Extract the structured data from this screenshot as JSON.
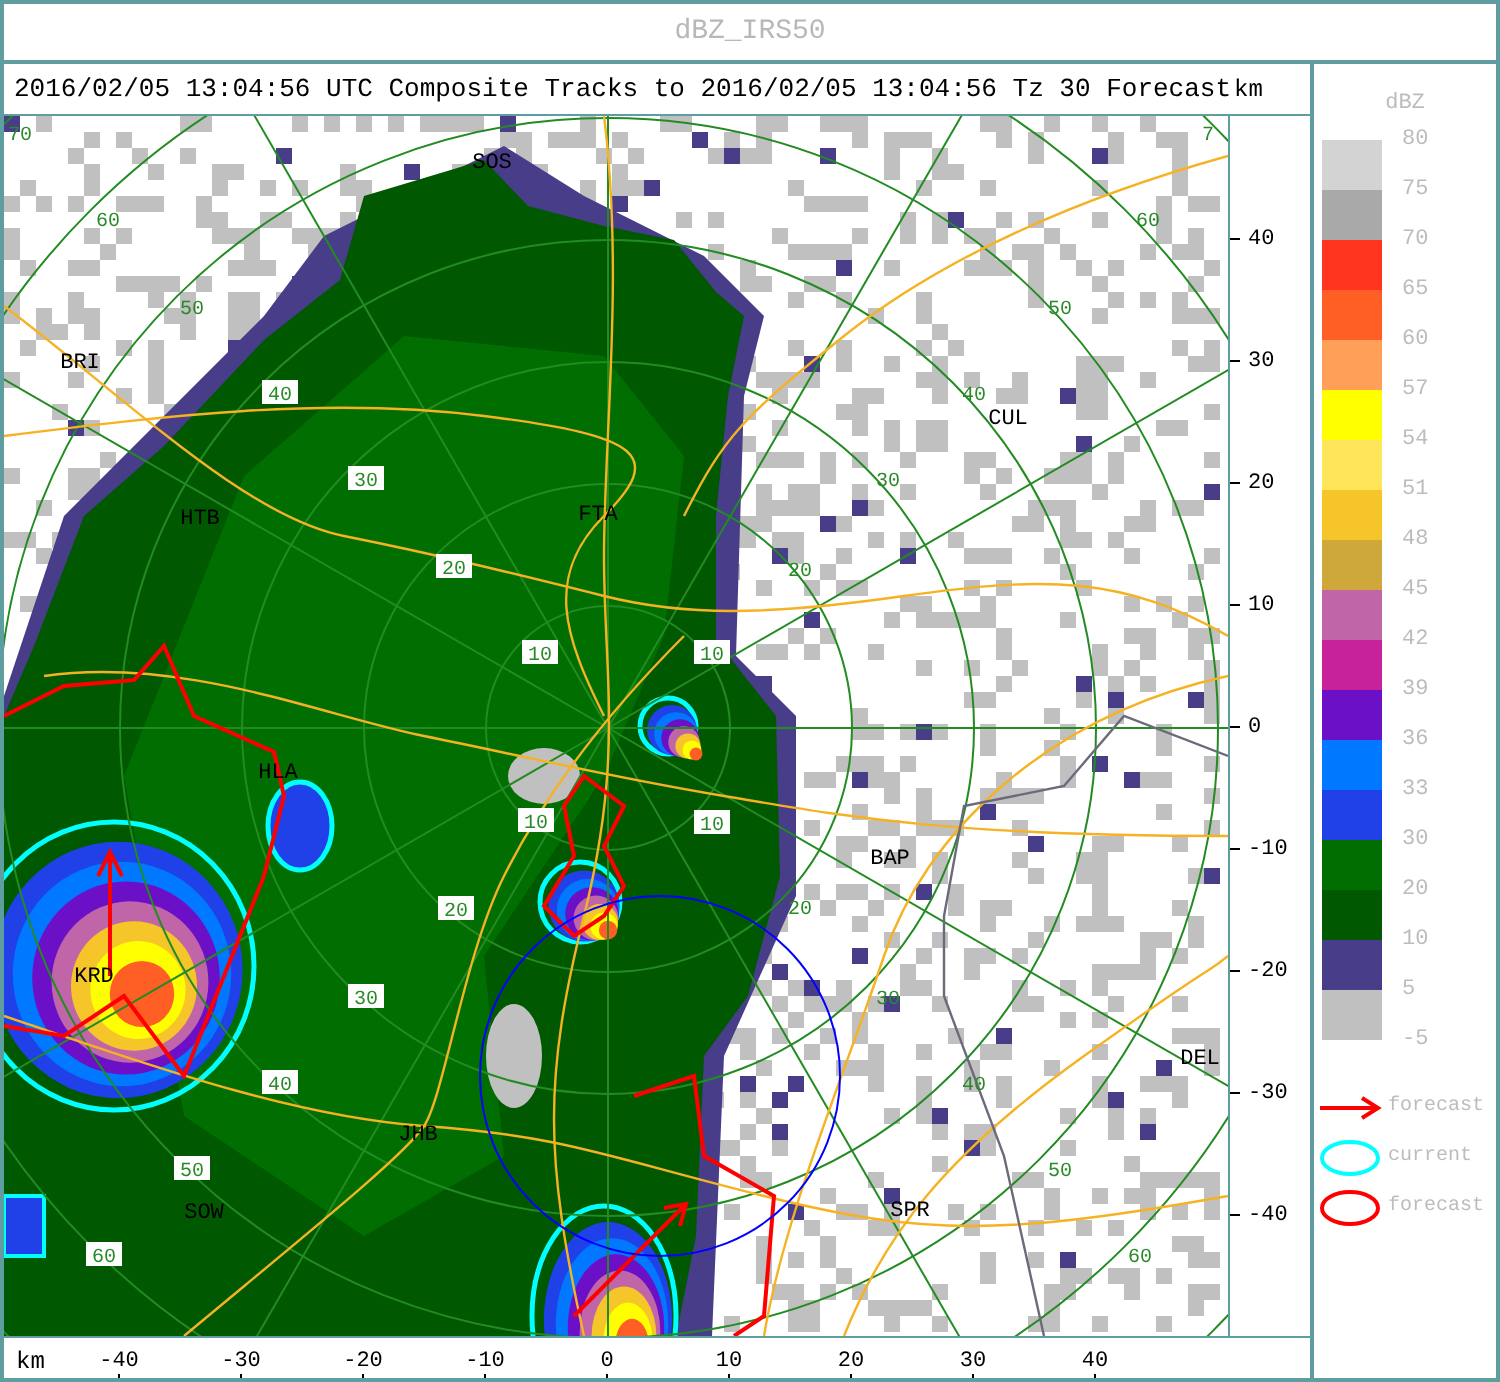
{
  "window": {
    "title": "dBZ_IRS50"
  },
  "header": {
    "text": "2016/02/05 13:04:56 UTC Composite Tracks to 2016/02/05 13:04:56 Tz 30 Forecast",
    "unit": "km"
  },
  "map": {
    "places": [
      "SOS",
      "BRI",
      "HTB",
      "FTA",
      "CUL",
      "HLA",
      "KRD",
      "BAP",
      "JHB",
      "SOW",
      "SPR",
      "DEL"
    ],
    "range_labels": [
      "70",
      "7",
      "60",
      "50",
      "40",
      "30",
      "20",
      "10",
      "60",
      "50",
      "40",
      "30",
      "20",
      "10",
      "10",
      "10",
      "20",
      "20",
      "30",
      "30",
      "40",
      "40",
      "50",
      "50",
      "60",
      "60"
    ]
  },
  "y_axis": {
    "ticks": [
      "40",
      "30",
      "20",
      "10",
      "0",
      "-10",
      "-20",
      "-30",
      "-40"
    ]
  },
  "x_axis": {
    "unit": "km",
    "ticks": [
      "-40",
      "-30",
      "-20",
      "-10",
      "0",
      "10",
      "20",
      "30",
      "40"
    ]
  },
  "legend": {
    "title": "dBZ",
    "labels": [
      "80",
      "75",
      "70",
      "65",
      "60",
      "57",
      "54",
      "51",
      "48",
      "45",
      "42",
      "39",
      "36",
      "33",
      "30",
      "20",
      "10",
      "5",
      "-5"
    ],
    "bins": [
      {
        "color": "#d3d3d3"
      },
      {
        "color": "#a9a9a9"
      },
      {
        "color": "#ff3520"
      },
      {
        "color": "#ff5f24"
      },
      {
        "color": "#ff9f58"
      },
      {
        "color": "#ffff00"
      },
      {
        "color": "#ffe55a"
      },
      {
        "color": "#f5c52a"
      },
      {
        "color": "#cfa83c"
      },
      {
        "color": "#c066a8"
      },
      {
        "color": "#c8229a"
      },
      {
        "color": "#6c10c8"
      },
      {
        "color": "#0078ff"
      },
      {
        "color": "#2040e8"
      },
      {
        "color": "#006e00"
      },
      {
        "color": "#005800"
      },
      {
        "color": "#483d88"
      },
      {
        "color": "#c0c0c0"
      }
    ],
    "symbols": [
      {
        "kind": "arrow",
        "label": "forecast"
      },
      {
        "kind": "current",
        "label": "current"
      },
      {
        "kind": "outline",
        "label": "forecast"
      }
    ]
  }
}
